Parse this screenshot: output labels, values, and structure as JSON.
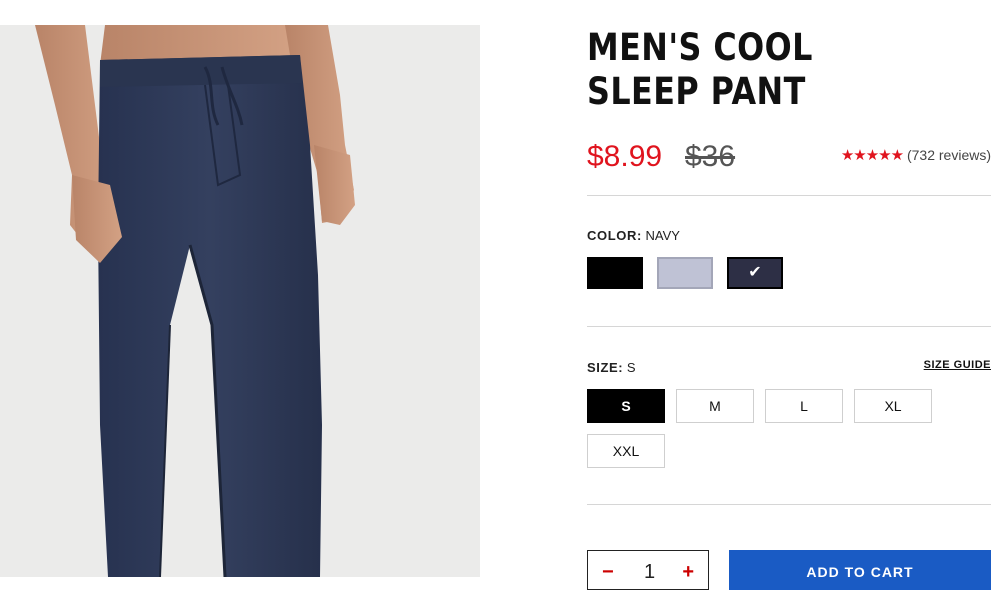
{
  "product": {
    "title": "MEN'S COOL SLEEP PANT",
    "sale_price": "$8.99",
    "original_price": "$36",
    "rating_stars": "★★★★★",
    "reviews": "(732 reviews)"
  },
  "color": {
    "label": "COLOR:",
    "selected": "NAVY",
    "swatches": [
      {
        "name": "Black",
        "hex": "#000000"
      },
      {
        "name": "Light Grey Blue",
        "hex": "#bfc2d5"
      },
      {
        "name": "Navy",
        "hex": "#2d2f45",
        "selected": true
      }
    ],
    "check": "✔"
  },
  "size": {
    "label": "SIZE:",
    "selected": "S",
    "guide": "SIZE GUIDE",
    "options": [
      "S",
      "M",
      "L",
      "XL",
      "XXL"
    ]
  },
  "cart": {
    "minus": "−",
    "quantity": "1",
    "plus": "+",
    "add_label": "ADD TO CART"
  },
  "colors": {
    "price_red": "#e0141e",
    "cart_blue": "#1a5bc4",
    "pant_navy": "#2e3a55"
  }
}
